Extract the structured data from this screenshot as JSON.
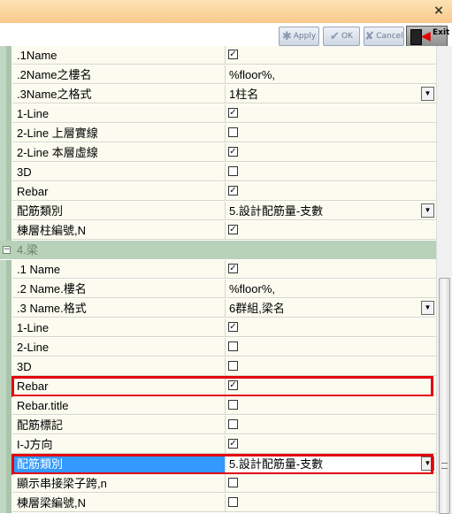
{
  "window": {
    "close_glyph": "×"
  },
  "toolbar": {
    "apply_label": "Apply",
    "ok_label": "OK",
    "cancel_label": "Cancel",
    "exit_label": "Exit"
  },
  "rows_top": [
    {
      "label": ".1Name",
      "type": "checkbox",
      "checked": true
    },
    {
      "label": ".2Name之樓名",
      "type": "text",
      "value": "%floor%,"
    },
    {
      "label": ".3Name之格式",
      "type": "dropdown",
      "value": "1柱名"
    },
    {
      "label": "1-Line",
      "type": "checkbox",
      "checked": true
    },
    {
      "label": "2-Line 上層實線",
      "type": "checkbox",
      "checked": false
    },
    {
      "label": "2-Line 本層虛線",
      "type": "checkbox",
      "checked": true
    },
    {
      "label": "3D",
      "type": "checkbox",
      "checked": false
    },
    {
      "label": "Rebar",
      "type": "checkbox",
      "checked": true
    },
    {
      "label": "配筋類別",
      "type": "dropdown",
      "value": "5.設計配筋量-支數"
    },
    {
      "label": "棟層柱編號,N",
      "type": "checkbox",
      "checked": true
    }
  ],
  "section": {
    "toggle": "−",
    "label": "4.梁"
  },
  "rows_beam": [
    {
      "label": ".1 Name",
      "type": "checkbox",
      "checked": true
    },
    {
      "label": ".2 Name.樓名",
      "type": "text",
      "value": "%floor%,"
    },
    {
      "label": ".3 Name.格式",
      "type": "dropdown",
      "value": "6群組,梁名"
    },
    {
      "label": "1-Line",
      "type": "checkbox",
      "checked": true
    },
    {
      "label": "2-Line",
      "type": "checkbox",
      "checked": false
    },
    {
      "label": "3D",
      "type": "checkbox",
      "checked": false
    },
    {
      "label": "Rebar",
      "type": "checkbox",
      "checked": true,
      "highlighted": true
    },
    {
      "label": "Rebar.title",
      "type": "checkbox",
      "checked": false
    },
    {
      "label": "配筋標記",
      "type": "checkbox",
      "checked": false
    },
    {
      "label": "I-J方向",
      "type": "checkbox",
      "checked": true
    },
    {
      "label": "配筋類別",
      "type": "dropdown",
      "value": "5.設計配筋量-支數",
      "highlighted": true,
      "selected": true
    },
    {
      "label": "顯示串接梁子跨,n",
      "type": "checkbox",
      "checked": false
    },
    {
      "label": "棟層梁編號,N",
      "type": "checkbox",
      "checked": false
    }
  ],
  "colors": {
    "highlight": "#e3000f",
    "selection": "#3399ff",
    "section_bg": "#b8d1b9"
  },
  "icons": {
    "apply": "apply-icon",
    "ok": "check-icon",
    "cancel": "x-icon",
    "exit": "exit-door-icon"
  }
}
